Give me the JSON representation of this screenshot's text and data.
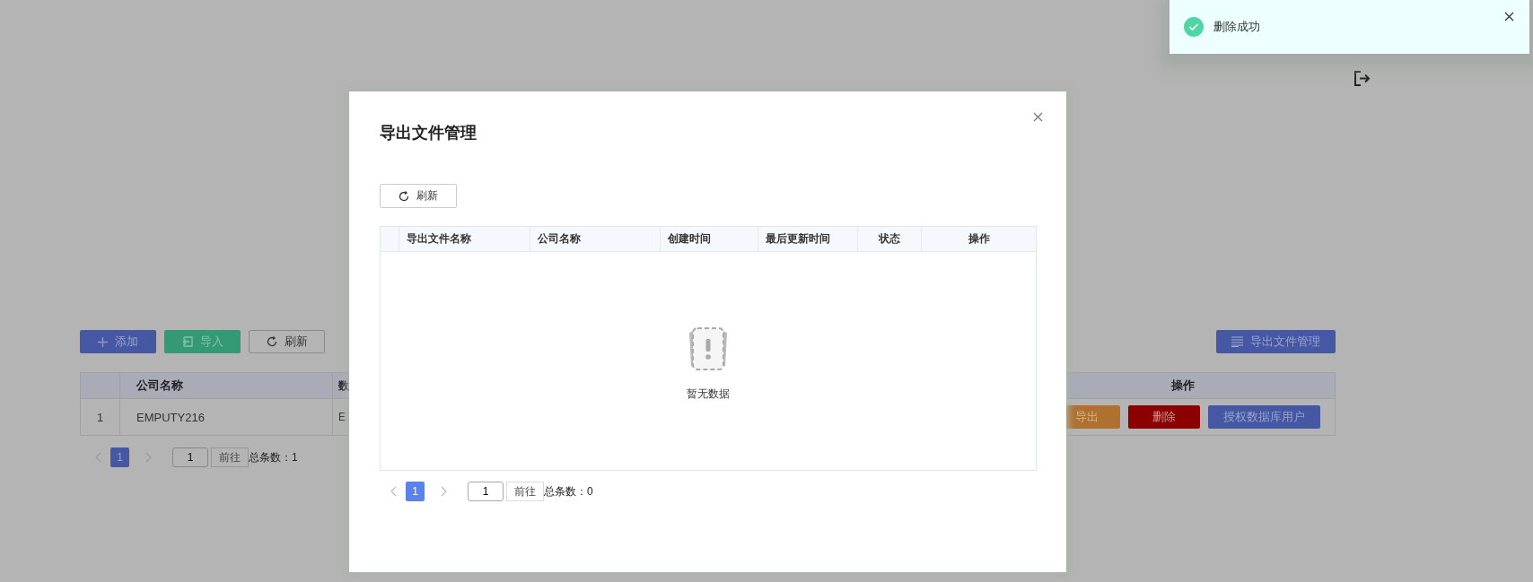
{
  "page": {
    "toolbar": [
      {
        "label": "添加",
        "kind": "add"
      },
      {
        "label": "导入",
        "kind": "import"
      },
      {
        "label": "刷新",
        "kind": "refresh"
      }
    ],
    "export_button": {
      "label": "导出文件管理"
    },
    "table": {
      "columns": [
        {
          "label": "公司名称"
        },
        {
          "label": "数"
        },
        {
          "label": "操作"
        }
      ],
      "rows": [
        {
          "index": "1",
          "company": "EMPUTY216",
          "column_3": "E",
          "actions": [
            {
              "label": "导出",
              "kind": "export"
            },
            {
              "label": "删除",
              "kind": "delete"
            },
            {
              "label": "授权数据库用户",
              "kind": "grant"
            }
          ]
        }
      ]
    },
    "pagination": {
      "pages": [
        {
          "label": "1",
          "selected": true
        }
      ],
      "jump_value": "1",
      "jump_button": "前往",
      "total": "总条数：1"
    }
  },
  "dialog": {
    "title": "导出文件管理",
    "refresh_button": "刷新",
    "table": {
      "columns": [
        {
          "label": "导出文件名称"
        },
        {
          "label": "公司名称"
        },
        {
          "label": "创建时间"
        },
        {
          "label": "最后更新时间"
        },
        {
          "label": "状态"
        },
        {
          "label": "操作"
        }
      ],
      "empty_text": "暂无数据"
    },
    "pagination": {
      "pages": [
        {
          "label": "1",
          "selected": true
        }
      ],
      "jump_value": "1",
      "jump_button": "前往",
      "total": "总条数：0"
    }
  },
  "toast": {
    "message": "删除成功",
    "kind": "success"
  }
}
